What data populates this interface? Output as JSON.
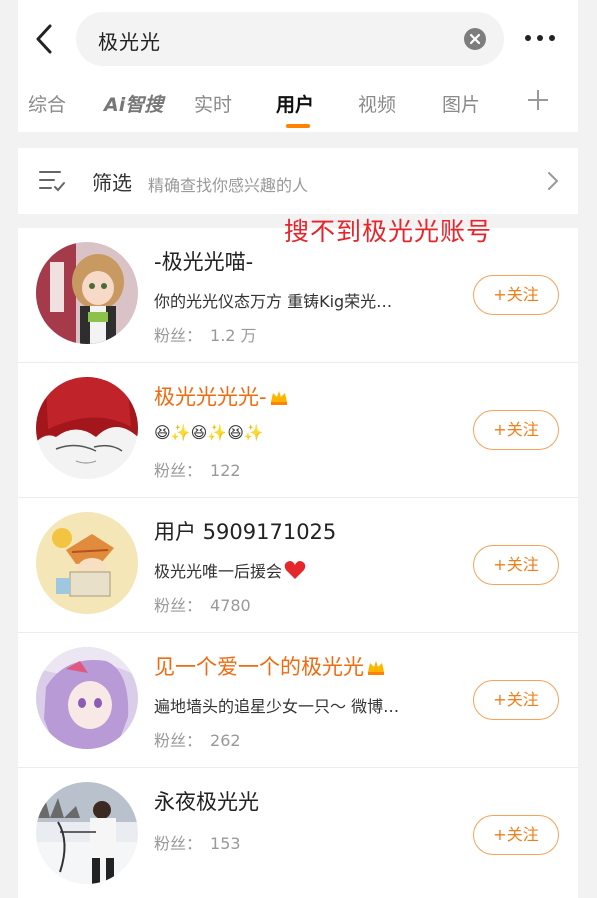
{
  "search": {
    "query": "极光光"
  },
  "tabs": [
    {
      "label": "综合"
    },
    {
      "label": "智搜",
      "logo": "Ai"
    },
    {
      "label": "实时"
    },
    {
      "label": "用户"
    },
    {
      "label": "视频"
    },
    {
      "label": "图片"
    }
  ],
  "active_tab": "用户",
  "filter": {
    "title": "筛选",
    "subtitle": "精确查找你感兴趣的人"
  },
  "annotation": "搜不到极光光账号",
  "fans_label": "粉丝：",
  "follow_label": "+关注",
  "users": [
    {
      "name": "-极光光喵-",
      "bio": "你的光光仪态万方  重铸Kig荣光…",
      "fans": "1.2 万",
      "name_color": "#222222",
      "avatar": "anime-girl-avatar"
    },
    {
      "name": "极光光光光-",
      "bio": "😆✨😆✨😆✨",
      "fans": "122",
      "name_color": "#f06a0f",
      "avatar": "red-hair-avatar",
      "vip": true
    },
    {
      "name": "用户 5909171025",
      "bio": "极光光唯一后援会",
      "fans": "4780",
      "name_color": "#222222",
      "avatar": "cartoon-avatar",
      "heart": true
    },
    {
      "name": "见一个爱一个的极光光",
      "bio": "遍地墙头的追星少女一只～ 微博…",
      "fans": "262",
      "name_color": "#f06a0f",
      "avatar": "purple-hair-avatar",
      "vip": true
    },
    {
      "name": "永夜极光光",
      "bio": "",
      "fans": "153",
      "name_color": "#222222",
      "avatar": "snow-photo-avatar"
    }
  ],
  "colors": {
    "accent": "#ff8200",
    "vip_name": "#f06a0f",
    "annotation": "#e8232a"
  }
}
